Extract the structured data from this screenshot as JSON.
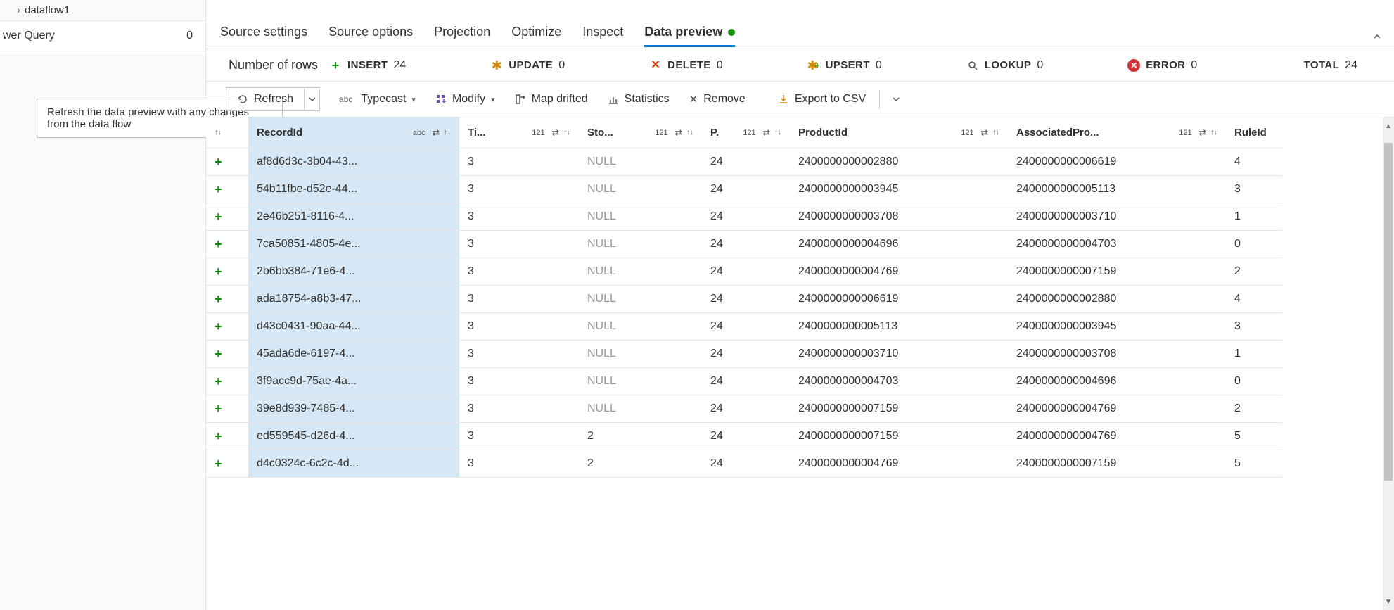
{
  "left": {
    "breadcrumb": "dataflow1",
    "section_name": "wer Query",
    "section_count": "0",
    "tooltip": "Refresh the data preview with any changes from the data flow"
  },
  "tabs": [
    {
      "label": "Source settings",
      "active": false
    },
    {
      "label": "Source options",
      "active": false
    },
    {
      "label": "Projection",
      "active": false
    },
    {
      "label": "Optimize",
      "active": false
    },
    {
      "label": "Inspect",
      "active": false
    },
    {
      "label": "Data preview",
      "active": true
    }
  ],
  "stats": {
    "lead": "Number of rows",
    "insert": {
      "label": "INSERT",
      "value": "24"
    },
    "update": {
      "label": "UPDATE",
      "value": "0"
    },
    "delete": {
      "label": "DELETE",
      "value": "0"
    },
    "upsert": {
      "label": "UPSERT",
      "value": "0"
    },
    "lookup": {
      "label": "LOOKUP",
      "value": "0"
    },
    "error": {
      "label": "ERROR",
      "value": "0"
    },
    "total": {
      "label": "TOTAL",
      "value": "24"
    }
  },
  "toolbar": {
    "refresh": "Refresh",
    "typecast": "Typecast",
    "modify": "Modify",
    "map_drifted": "Map drifted",
    "statistics": "Statistics",
    "remove": "Remove",
    "export_csv": "Export to CSV"
  },
  "columns": [
    {
      "name": "",
      "type": ""
    },
    {
      "name": "RecordId",
      "type": "abc"
    },
    {
      "name": "Ti...",
      "type": "121"
    },
    {
      "name": "Sto...",
      "type": "121"
    },
    {
      "name": "P.",
      "type": "121"
    },
    {
      "name": "ProductId",
      "type": "121"
    },
    {
      "name": "AssociatedPro...",
      "type": "121"
    },
    {
      "name": "RuleId",
      "type": ""
    }
  ],
  "rows": [
    {
      "record": "af8d6d3c-3b04-43...",
      "ti": "3",
      "sto": "NULL",
      "p": "24",
      "product": "2400000000002880",
      "assoc": "2400000000006619",
      "rule": "4"
    },
    {
      "record": "54b11fbe-d52e-44...",
      "ti": "3",
      "sto": "NULL",
      "p": "24",
      "product": "2400000000003945",
      "assoc": "2400000000005113",
      "rule": "3"
    },
    {
      "record": "2e46b251-8116-4...",
      "ti": "3",
      "sto": "NULL",
      "p": "24",
      "product": "2400000000003708",
      "assoc": "2400000000003710",
      "rule": "1"
    },
    {
      "record": "7ca50851-4805-4e...",
      "ti": "3",
      "sto": "NULL",
      "p": "24",
      "product": "2400000000004696",
      "assoc": "2400000000004703",
      "rule": "0"
    },
    {
      "record": "2b6bb384-71e6-4...",
      "ti": "3",
      "sto": "NULL",
      "p": "24",
      "product": "2400000000004769",
      "assoc": "2400000000007159",
      "rule": "2"
    },
    {
      "record": "ada18754-a8b3-47...",
      "ti": "3",
      "sto": "NULL",
      "p": "24",
      "product": "2400000000006619",
      "assoc": "2400000000002880",
      "rule": "4"
    },
    {
      "record": "d43c0431-90aa-44...",
      "ti": "3",
      "sto": "NULL",
      "p": "24",
      "product": "2400000000005113",
      "assoc": "2400000000003945",
      "rule": "3"
    },
    {
      "record": "45ada6de-6197-4...",
      "ti": "3",
      "sto": "NULL",
      "p": "24",
      "product": "2400000000003710",
      "assoc": "2400000000003708",
      "rule": "1"
    },
    {
      "record": "3f9acc9d-75ae-4a...",
      "ti": "3",
      "sto": "NULL",
      "p": "24",
      "product": "2400000000004703",
      "assoc": "2400000000004696",
      "rule": "0"
    },
    {
      "record": "39e8d939-7485-4...",
      "ti": "3",
      "sto": "NULL",
      "p": "24",
      "product": "2400000000007159",
      "assoc": "2400000000004769",
      "rule": "2"
    },
    {
      "record": "ed559545-d26d-4...",
      "ti": "3",
      "sto": "2",
      "p": "24",
      "product": "2400000000007159",
      "assoc": "2400000000004769",
      "rule": "5"
    },
    {
      "record": "d4c0324c-6c2c-4d...",
      "ti": "3",
      "sto": "2",
      "p": "24",
      "product": "2400000000004769",
      "assoc": "2400000000007159",
      "rule": "5"
    }
  ]
}
